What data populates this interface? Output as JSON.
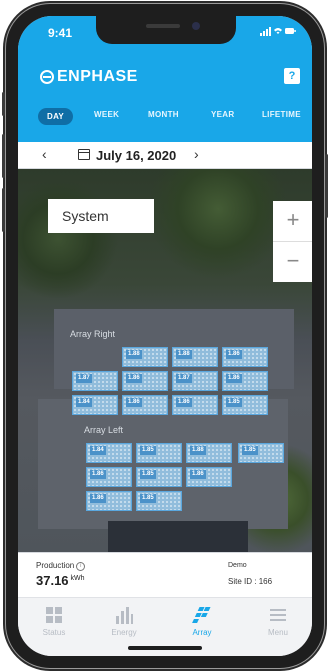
{
  "status_bar": {
    "time": "9:41",
    "indicators": "signal-wifi-battery"
  },
  "header": {
    "brand": "ENPHASE",
    "help_label": "?"
  },
  "range_tabs": [
    {
      "label": "DAY",
      "active": true
    },
    {
      "label": "WEEK",
      "active": false
    },
    {
      "label": "MONTH",
      "active": false
    },
    {
      "label": "YEAR",
      "active": false
    },
    {
      "label": "LIFETIME",
      "active": false
    }
  ],
  "date_nav": {
    "prev": "‹",
    "date": "July 16, 2020",
    "next": "›"
  },
  "map": {
    "view_selector": "System",
    "zoom_in": "+",
    "zoom_out": "−",
    "arrays": [
      {
        "name": "Array Right",
        "panels": [
          "1.88",
          "1.88",
          "1.86",
          "1.87",
          "1.86",
          "1.87",
          "1.86",
          "1.84",
          "1.86",
          "1.86",
          "1.85"
        ]
      },
      {
        "name": "Array Left",
        "panels": [
          "1.84",
          "1.85",
          "1.88",
          "1.85",
          "1.86",
          "1.85",
          "1.86",
          "1.86",
          "1.85"
        ]
      }
    ],
    "panel_unit": "kWh"
  },
  "production": {
    "label": "Production",
    "value": "37.16",
    "unit": "kWh",
    "demo_label": "Demo",
    "site_id_label": "Site ID :",
    "site_id": "166"
  },
  "bottom_nav": [
    {
      "label": "Status",
      "active": false
    },
    {
      "label": "Energy",
      "active": false
    },
    {
      "label": "Array",
      "active": true
    },
    {
      "label": "Menu",
      "active": false
    }
  ],
  "colors": {
    "brand_blue": "#19a7e8",
    "active_tab_bg": "#0f6ea6",
    "panel_fill": "#9accf0"
  }
}
